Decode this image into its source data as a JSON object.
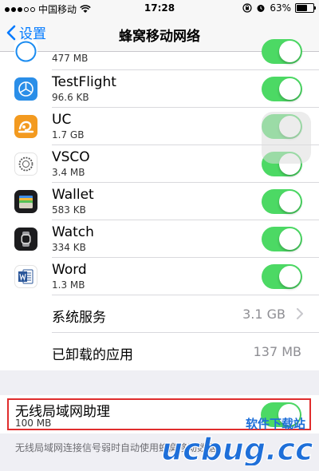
{
  "status_bar": {
    "carrier": "中国移动",
    "time": "17:28",
    "battery": "63%",
    "battery_level": 0.63
  },
  "nav": {
    "back_label": "设置",
    "title": "蜂窝移动网络"
  },
  "apps": [
    {
      "name": "",
      "size": "477 MB",
      "icon": "safari-icon",
      "enabled": true
    },
    {
      "name": "TestFlight",
      "size": "96.6 KB",
      "icon": "testflight-icon",
      "enabled": true
    },
    {
      "name": "UC",
      "size": "1.7 GB",
      "icon": "uc-browser-icon",
      "enabled": true
    },
    {
      "name": "VSCO",
      "size": "3.4 MB",
      "icon": "vsco-icon",
      "enabled": true
    },
    {
      "name": "Wallet",
      "size": "583 KB",
      "icon": "wallet-icon",
      "enabled": true
    },
    {
      "name": "Watch",
      "size": "334 KB",
      "icon": "watch-icon",
      "enabled": true
    },
    {
      "name": "Word",
      "size": "1.3 MB",
      "icon": "word-icon",
      "enabled": true
    }
  ],
  "system_services": {
    "label": "系统服务",
    "value": "3.1 GB"
  },
  "uninstalled_apps": {
    "label": "已卸载的应用",
    "value": "137 MB"
  },
  "wifi_assist": {
    "label": "无线局域网助理",
    "size": "100 MB",
    "enabled": true,
    "note": "无线局域网连接信号弱时自动使用蜂窝移动数据。"
  },
  "watermark": {
    "text": "软件下载站",
    "logo": "ucbug.cc"
  },
  "colors": {
    "accent": "#007aff",
    "toggle_on": "#4cd964",
    "highlight": "#e02d2d",
    "watermark": "#1e6fd9"
  }
}
